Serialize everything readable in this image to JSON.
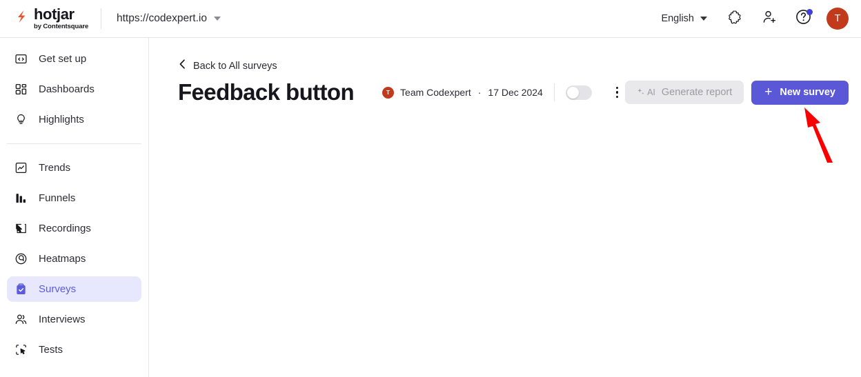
{
  "topbar": {
    "logo_name": "hotjar",
    "logo_sub": "by Contentsquare",
    "logo_mark_icon": "hotjar-flame-icon",
    "site_url": "https://codexpert.io",
    "site_caret_icon": "chevron-down-icon",
    "language": "English",
    "language_caret_icon": "chevron-down-icon",
    "puzzle_icon": "puzzle-piece-icon",
    "invite_icon": "add-user-icon",
    "help_icon": "help-circle-icon",
    "help_badge": true,
    "avatar_initial": "T"
  },
  "sidebar": {
    "groups": [
      {
        "items": [
          {
            "label": "Get set up",
            "icon": "code-window-icon",
            "active": false
          },
          {
            "label": "Dashboards",
            "icon": "dashboard-grid-icon",
            "active": false
          },
          {
            "label": "Highlights",
            "icon": "lightbulb-icon",
            "active": false
          }
        ]
      },
      {
        "items": [
          {
            "label": "Trends",
            "icon": "trend-chart-icon",
            "active": false
          },
          {
            "label": "Funnels",
            "icon": "funnel-bars-icon",
            "active": false
          },
          {
            "label": "Recordings",
            "icon": "recording-cursor-icon",
            "active": false
          },
          {
            "label": "Heatmaps",
            "icon": "heatmap-icon",
            "active": false
          },
          {
            "label": "Surveys",
            "icon": "clipboard-check-icon",
            "active": true
          },
          {
            "label": "Interviews",
            "icon": "people-icon",
            "active": false
          },
          {
            "label": "Tests",
            "icon": "select-cursor-icon",
            "active": false
          }
        ]
      }
    ]
  },
  "main": {
    "back_link": "Back to All surveys",
    "back_icon": "chevron-left-icon",
    "page_title": "Feedback button",
    "meta": {
      "team_avatar_initial": "T",
      "team_name": "Team Codexpert",
      "separator": "·",
      "date": "17 Dec 2024"
    },
    "toggle": {
      "name": "survey-status-toggle",
      "state": "off"
    },
    "kebab_icon": "more-vertical-icon",
    "ai_button": {
      "tag": "AI",
      "tag_icon": "sparkle-icon",
      "label": "Generate report",
      "disabled": true
    },
    "new_survey_button": {
      "label": "New survey",
      "icon": "plus-icon"
    }
  },
  "annotation": {
    "arrow_icon": "red-arrow-up-left-icon",
    "arrow_color": "#fc0000"
  },
  "colors": {
    "accent_purple": "#5a58d6",
    "active_nav_bg": "#e7e8fd",
    "active_nav_text": "#5b5bdc",
    "avatar_red": "#c13a1c",
    "badge_blue": "#4040d8",
    "disabled_bg": "#e9e9ec",
    "disabled_text": "#9a9aa3",
    "border": "#e6e6e8",
    "text_primary": "#16161c"
  }
}
